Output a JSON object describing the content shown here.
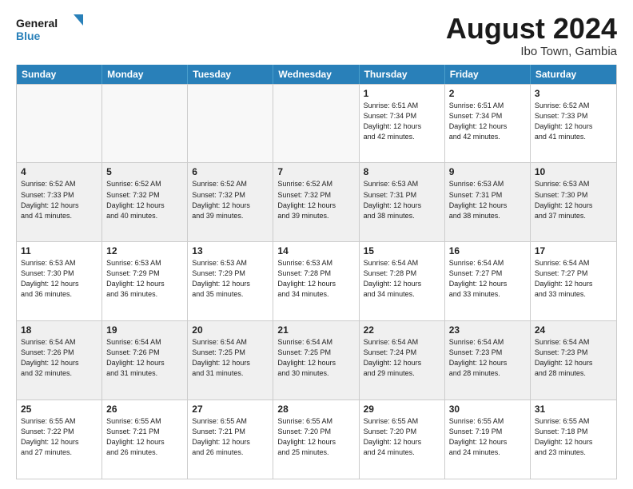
{
  "header": {
    "logo_general": "General",
    "logo_blue": "Blue",
    "month": "August 2024",
    "location": "Ibo Town, Gambia"
  },
  "days_of_week": [
    "Sunday",
    "Monday",
    "Tuesday",
    "Wednesday",
    "Thursday",
    "Friday",
    "Saturday"
  ],
  "weeks": [
    [
      {
        "day": "",
        "info": ""
      },
      {
        "day": "",
        "info": ""
      },
      {
        "day": "",
        "info": ""
      },
      {
        "day": "",
        "info": ""
      },
      {
        "day": "1",
        "info": "Sunrise: 6:51 AM\nSunset: 7:34 PM\nDaylight: 12 hours\nand 42 minutes."
      },
      {
        "day": "2",
        "info": "Sunrise: 6:51 AM\nSunset: 7:34 PM\nDaylight: 12 hours\nand 42 minutes."
      },
      {
        "day": "3",
        "info": "Sunrise: 6:52 AM\nSunset: 7:33 PM\nDaylight: 12 hours\nand 41 minutes."
      }
    ],
    [
      {
        "day": "4",
        "info": "Sunrise: 6:52 AM\nSunset: 7:33 PM\nDaylight: 12 hours\nand 41 minutes."
      },
      {
        "day": "5",
        "info": "Sunrise: 6:52 AM\nSunset: 7:32 PM\nDaylight: 12 hours\nand 40 minutes."
      },
      {
        "day": "6",
        "info": "Sunrise: 6:52 AM\nSunset: 7:32 PM\nDaylight: 12 hours\nand 39 minutes."
      },
      {
        "day": "7",
        "info": "Sunrise: 6:52 AM\nSunset: 7:32 PM\nDaylight: 12 hours\nand 39 minutes."
      },
      {
        "day": "8",
        "info": "Sunrise: 6:53 AM\nSunset: 7:31 PM\nDaylight: 12 hours\nand 38 minutes."
      },
      {
        "day": "9",
        "info": "Sunrise: 6:53 AM\nSunset: 7:31 PM\nDaylight: 12 hours\nand 38 minutes."
      },
      {
        "day": "10",
        "info": "Sunrise: 6:53 AM\nSunset: 7:30 PM\nDaylight: 12 hours\nand 37 minutes."
      }
    ],
    [
      {
        "day": "11",
        "info": "Sunrise: 6:53 AM\nSunset: 7:30 PM\nDaylight: 12 hours\nand 36 minutes."
      },
      {
        "day": "12",
        "info": "Sunrise: 6:53 AM\nSunset: 7:29 PM\nDaylight: 12 hours\nand 36 minutes."
      },
      {
        "day": "13",
        "info": "Sunrise: 6:53 AM\nSunset: 7:29 PM\nDaylight: 12 hours\nand 35 minutes."
      },
      {
        "day": "14",
        "info": "Sunrise: 6:53 AM\nSunset: 7:28 PM\nDaylight: 12 hours\nand 34 minutes."
      },
      {
        "day": "15",
        "info": "Sunrise: 6:54 AM\nSunset: 7:28 PM\nDaylight: 12 hours\nand 34 minutes."
      },
      {
        "day": "16",
        "info": "Sunrise: 6:54 AM\nSunset: 7:27 PM\nDaylight: 12 hours\nand 33 minutes."
      },
      {
        "day": "17",
        "info": "Sunrise: 6:54 AM\nSunset: 7:27 PM\nDaylight: 12 hours\nand 33 minutes."
      }
    ],
    [
      {
        "day": "18",
        "info": "Sunrise: 6:54 AM\nSunset: 7:26 PM\nDaylight: 12 hours\nand 32 minutes."
      },
      {
        "day": "19",
        "info": "Sunrise: 6:54 AM\nSunset: 7:26 PM\nDaylight: 12 hours\nand 31 minutes."
      },
      {
        "day": "20",
        "info": "Sunrise: 6:54 AM\nSunset: 7:25 PM\nDaylight: 12 hours\nand 31 minutes."
      },
      {
        "day": "21",
        "info": "Sunrise: 6:54 AM\nSunset: 7:25 PM\nDaylight: 12 hours\nand 30 minutes."
      },
      {
        "day": "22",
        "info": "Sunrise: 6:54 AM\nSunset: 7:24 PM\nDaylight: 12 hours\nand 29 minutes."
      },
      {
        "day": "23",
        "info": "Sunrise: 6:54 AM\nSunset: 7:23 PM\nDaylight: 12 hours\nand 28 minutes."
      },
      {
        "day": "24",
        "info": "Sunrise: 6:54 AM\nSunset: 7:23 PM\nDaylight: 12 hours\nand 28 minutes."
      }
    ],
    [
      {
        "day": "25",
        "info": "Sunrise: 6:55 AM\nSunset: 7:22 PM\nDaylight: 12 hours\nand 27 minutes."
      },
      {
        "day": "26",
        "info": "Sunrise: 6:55 AM\nSunset: 7:21 PM\nDaylight: 12 hours\nand 26 minutes."
      },
      {
        "day": "27",
        "info": "Sunrise: 6:55 AM\nSunset: 7:21 PM\nDaylight: 12 hours\nand 26 minutes."
      },
      {
        "day": "28",
        "info": "Sunrise: 6:55 AM\nSunset: 7:20 PM\nDaylight: 12 hours\nand 25 minutes."
      },
      {
        "day": "29",
        "info": "Sunrise: 6:55 AM\nSunset: 7:20 PM\nDaylight: 12 hours\nand 24 minutes."
      },
      {
        "day": "30",
        "info": "Sunrise: 6:55 AM\nSunset: 7:19 PM\nDaylight: 12 hours\nand 24 minutes."
      },
      {
        "day": "31",
        "info": "Sunrise: 6:55 AM\nSunset: 7:18 PM\nDaylight: 12 hours\nand 23 minutes."
      }
    ]
  ]
}
